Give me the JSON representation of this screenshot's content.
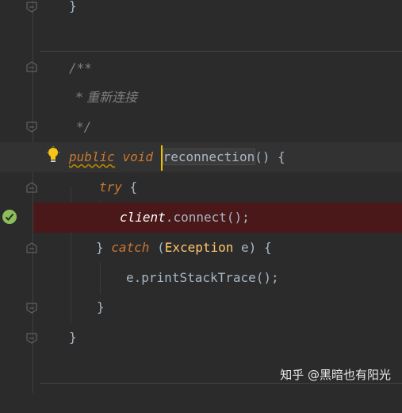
{
  "editor": {
    "lines": {
      "brace_top": "}",
      "javadoc_start": "/**",
      "javadoc_body": "* 重新连接",
      "javadoc_end": "*/",
      "sig_public": "public",
      "sig_void": "void",
      "sig_name": "reconnection",
      "sig_rest": "() {",
      "try_kw": "try",
      "try_brace": " {",
      "call_obj": "client",
      "call_dot": ".",
      "call_method": "connect",
      "call_rest": "();",
      "catch_open": "} ",
      "catch_kw": "catch",
      "catch_paren": " (",
      "catch_type": "Exception",
      "catch_var": " e",
      "catch_close": ") {",
      "print_obj": "e",
      "print_dot": ".",
      "print_method": "printStackTrace",
      "print_rest": "();",
      "brace_inner": "}",
      "brace_outer": "}"
    }
  },
  "watermark": "知乎 @黑暗也有阳光",
  "colors": {
    "background": "#2b2b2b",
    "keyword": "#cc7832",
    "comment": "#808080",
    "breakpoint_line": "#4a1818",
    "caret": "#f0c000"
  },
  "icons": {
    "gutter": "fold-marker-icon",
    "intention": "lightbulb-icon",
    "breakpoint": "breakpoint-check-icon"
  }
}
